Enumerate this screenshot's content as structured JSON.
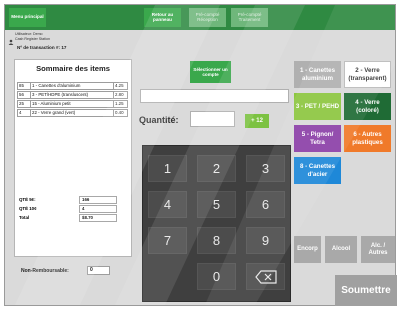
{
  "topbar": {
    "menu_label": "Menu principal",
    "back_label": "Retour au panneau",
    "prev_receipt_label": "Pré-compté Réception",
    "prev_processing_label": "Pré-compté Traitement"
  },
  "header": {
    "user": "Utilisateur: Demo",
    "station": "Cash Register Station",
    "transaction_label": "Nº de transaction #:",
    "transaction_number": "17"
  },
  "summary": {
    "title": "Sommaire des items",
    "rows": [
      {
        "code": "85",
        "desc": "1 - Canettes d'aluminium",
        "amount": "4.25"
      },
      {
        "code": "56",
        "desc": "3 - PET/HDPE (transluscent)",
        "amount": "2.80"
      },
      {
        "code": "25",
        "desc": "15 - Aluminium petit",
        "amount": "1.25"
      },
      {
        "code": "4",
        "desc": "22 - Verre grand (vert)",
        "amount": "0.40"
      }
    ],
    "qte5_label": "QTÉ 5¢:",
    "qte5_value": "166",
    "qte10_label": "QTÉ 10¢",
    "qte10_value": "4",
    "total_label": "Total",
    "total_value": "$8.70"
  },
  "nonrefundable": {
    "label": "Non-Remboursable:",
    "value": "0"
  },
  "account": {
    "select_label": "Sélectionner un compte",
    "value": ""
  },
  "quantity": {
    "label": "Quantité:",
    "value": "",
    "plus_label": "+ 12"
  },
  "keypad": {
    "keys": [
      "1",
      "2",
      "3",
      "4",
      "5",
      "6",
      "7",
      "8",
      "9",
      "0"
    ]
  },
  "categories": {
    "cat1": "1 - Canettes aluminium",
    "cat2": "2 - Verre (transparent)",
    "cat3": "3 - PET / PEHD",
    "cat4": "4 - Verre (coloré)",
    "cat5": "5 - Pignon/ Tetra",
    "cat6": "6 - Autres plastiques",
    "cat8": "8 - Canettes d'acier"
  },
  "bottom_buttons": {
    "encorp": "Encorp",
    "alcool": "Alcool",
    "alc_autres": "Alc. / Autres"
  },
  "submit_label": "Soumettre",
  "colors": {
    "topbar": "#2f8a42",
    "accent_green": "#3aa84c",
    "plus_green": "#7cc242",
    "cat_aluminium": "#b0b0b0",
    "cat_glass_clear": "#ffffff",
    "cat_pet": "#8cc63f",
    "cat_glass_colored": "#1f6b35",
    "cat_tetra": "#8b3fa8",
    "cat_plastics": "#f07a2a",
    "cat_steel": "#1e88d8",
    "keypad": "#3f3f3f"
  }
}
